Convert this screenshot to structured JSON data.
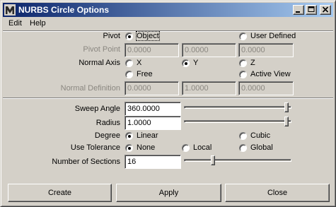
{
  "window": {
    "title": "NURBS Circle Options",
    "app_icon": "maya-icon",
    "title_bar_color": "#0a246a"
  },
  "menu": [
    "Edit",
    "Help"
  ],
  "pivot": {
    "label": "Pivot",
    "options": [
      "Object",
      "User Defined"
    ],
    "selected": "Object"
  },
  "pivot_point": {
    "label": "Pivot Point",
    "values": [
      "0.0000",
      "0.0000",
      "0.0000"
    ],
    "enabled": false
  },
  "normal_axis": {
    "label": "Normal Axis",
    "options": [
      "X",
      "Y",
      "Z",
      "Free",
      "Active View"
    ],
    "selected": "Y"
  },
  "normal_definition": {
    "label": "Normal Definition",
    "values": [
      "0.0000",
      "1.0000",
      "0.0000"
    ],
    "enabled": false
  },
  "sweep_angle": {
    "label": "Sweep Angle",
    "value": "360.0000",
    "slider_fraction": 1.0
  },
  "radius": {
    "label": "Radius",
    "value": "1.0000",
    "slider_fraction": 1.0
  },
  "degree": {
    "label": "Degree",
    "options": [
      "Linear",
      "Cubic"
    ],
    "selected": "Linear"
  },
  "use_tolerance": {
    "label": "Use Tolerance",
    "options": [
      "None",
      "Local",
      "Global"
    ],
    "selected": "None"
  },
  "number_of_sections": {
    "label": "Number of Sections",
    "value": "16",
    "slider_fraction": 0.27
  },
  "buttons": {
    "create": "Create",
    "apply": "Apply",
    "close": "Close"
  }
}
